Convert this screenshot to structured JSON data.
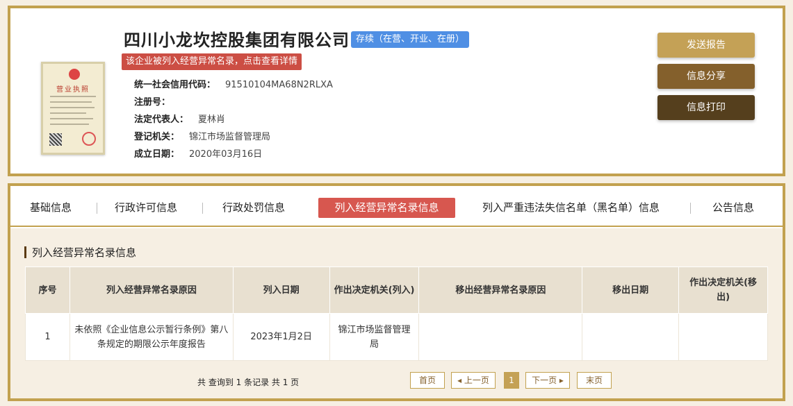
{
  "company": {
    "name": "四川小龙坎控股集团有限公司",
    "status": "存续（在营、开业、在册）",
    "abnormal_notice": "该企业被列入经营异常名录，点击查看详情",
    "license_title": "营业执照"
  },
  "info": [
    {
      "label": "统一社会信用代码：",
      "value": "91510104MA68N2RLXA"
    },
    {
      "label": "注册号：",
      "value": ""
    },
    {
      "label": "法定代表人：",
      "value": "夏林肖"
    },
    {
      "label": "登记机关：",
      "value": "锦江市场监督管理局"
    },
    {
      "label": "成立日期：",
      "value": "2020年03月16日"
    }
  ],
  "actions": {
    "send_report": "发送报告",
    "share": "信息分享",
    "print": "信息打印"
  },
  "tabs": [
    {
      "label": "基础信息"
    },
    {
      "label": "行政许可信息"
    },
    {
      "label": "行政处罚信息"
    },
    {
      "label": "列入经营异常名录信息"
    },
    {
      "label": "列入严重违法失信名单（黑名单）信息"
    },
    {
      "label": "公告信息"
    }
  ],
  "section": {
    "title": "列入经营异常名录信息"
  },
  "table": {
    "headers": [
      "序号",
      "列入经营异常名录原因",
      "列入日期",
      "作出决定机关(列入)",
      "移出经营异常名录原因",
      "移出日期",
      "作出决定机关(移出)"
    ],
    "rows": [
      [
        "1",
        "未依照《企业信息公示暂行条例》第八条规定的期限公示年度报告",
        "2023年1月2日",
        "锦江市场监督管理局",
        "",
        "",
        ""
      ]
    ]
  },
  "pagination": {
    "summary": "共 查询到 1 条记录 共 1 页",
    "first": "首页",
    "prev": "◂ 上一页",
    "current": "1",
    "next": "下一页 ▸",
    "last": "末页"
  },
  "colors": {
    "gold": "#c2a14f",
    "status_blue": "#4f8fe4",
    "alert_red": "#cc4e44",
    "active_tab": "#d7574f"
  }
}
